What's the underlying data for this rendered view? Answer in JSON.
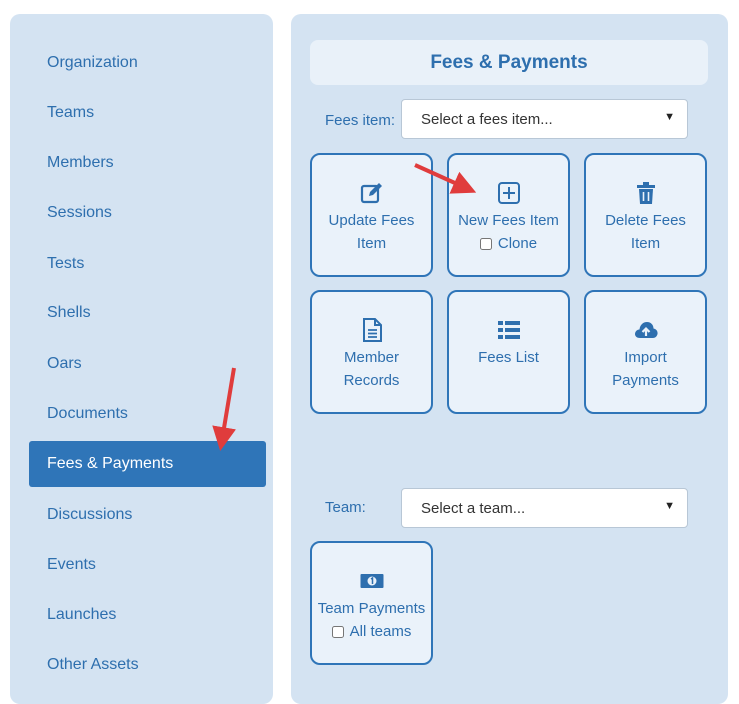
{
  "sidebar": {
    "items": [
      {
        "label": "Organization"
      },
      {
        "label": "Teams"
      },
      {
        "label": "Members"
      },
      {
        "label": "Sessions"
      },
      {
        "label": "Tests"
      },
      {
        "label": "Shells"
      },
      {
        "label": "Oars"
      },
      {
        "label": "Documents"
      },
      {
        "label": "Fees & Payments",
        "active": true
      },
      {
        "label": "Discussions"
      },
      {
        "label": "Events"
      },
      {
        "label": "Launches"
      },
      {
        "label": "Other Assets"
      }
    ]
  },
  "main": {
    "title": "Fees & Payments",
    "fees_item_label": "Fees item:",
    "fees_item_select": "Select a fees item...",
    "team_label": "Team:",
    "team_select": "Select a team...",
    "tiles": {
      "update": {
        "line1": "Update Fees",
        "line2": "Item",
        "icon": "edit-icon"
      },
      "new": {
        "line1": "New Fees Item",
        "check_label": "Clone",
        "icon": "plus-square-icon"
      },
      "delete": {
        "line1": "Delete Fees",
        "line2": "Item",
        "icon": "trash-icon"
      },
      "member_records": {
        "line1": "Member",
        "line2": "Records",
        "icon": "document-icon"
      },
      "fees_list": {
        "line1": "Fees List",
        "icon": "list-icon"
      },
      "import": {
        "line1": "Import",
        "line2": "Payments",
        "icon": "cloud-upload-icon"
      },
      "team_payments": {
        "line1": "Team Payments",
        "check_label": "All teams",
        "icon": "money-icon"
      }
    }
  },
  "colors": {
    "accent": "#2f75b8",
    "panel": "#d4e3f2",
    "tile": "#eaf2fa",
    "arrow": "#e03c3c"
  }
}
